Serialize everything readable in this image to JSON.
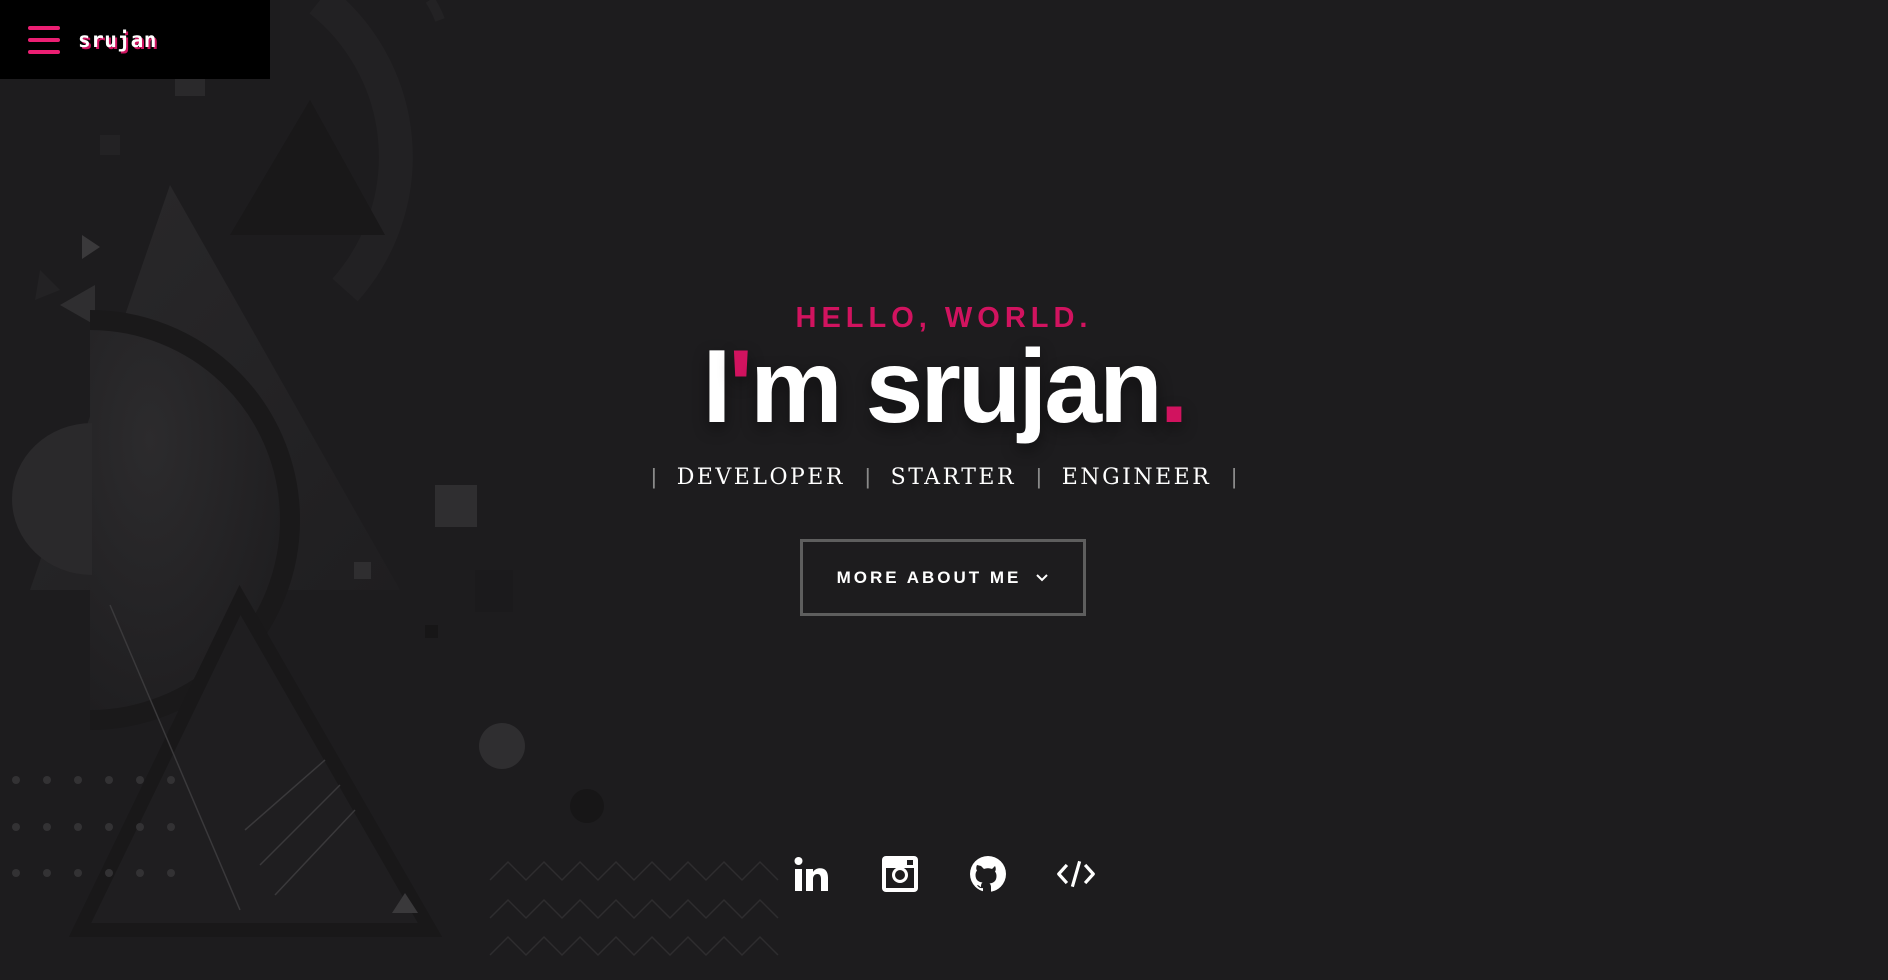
{
  "header": {
    "logo": "srujan",
    "menu_icon": "hamburger-menu-icon"
  },
  "hero": {
    "greeting": "HELLO, WORLD.",
    "headline_prefix": "I",
    "headline_apostrophe": "'",
    "headline_rest": "m srujan",
    "headline_dot": ".",
    "roles": [
      "DEVELOPER",
      "STARTER",
      "ENGINEER"
    ],
    "cta_label": "MORE ABOUT ME"
  },
  "socials": [
    {
      "name": "linkedin-icon"
    },
    {
      "name": "instagram-icon"
    },
    {
      "name": "github-icon"
    },
    {
      "name": "code-icon"
    }
  ],
  "colors": {
    "accent": "#d1135f",
    "menu": "#ec1f73",
    "background": "#1d1c1e",
    "topbar": "#000000"
  }
}
